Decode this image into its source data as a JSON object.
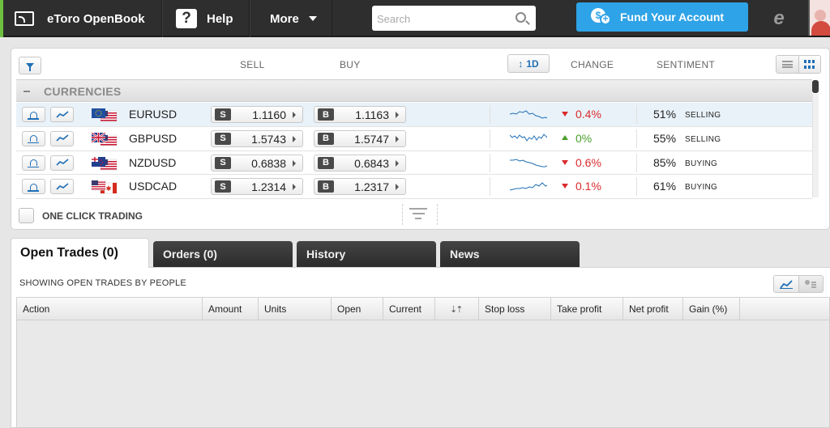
{
  "topbar": {
    "openbook_label": "eToro OpenBook",
    "help_label": "Help",
    "help_icon": "?",
    "more_label": "More",
    "search_placeholder": "Search",
    "fund_label": "Fund Your Account",
    "fund_icon_primary": "$",
    "fund_icon_plus": "+",
    "logo_glyph": "e"
  },
  "markets": {
    "headers": {
      "sell": "SELL",
      "buy": "BUY",
      "change": "CHANGE",
      "sentiment": "SENTIMENT"
    },
    "period": "1D",
    "period_icon": "↕",
    "category": "CURRENCIES",
    "rows": [
      {
        "symbol": "EURUSD",
        "sell_tag": "S",
        "sell": "1.1160",
        "buy_tag": "B",
        "buy": "1.1163",
        "direction": "down",
        "change": "0.4%",
        "pct": "51%",
        "sentiment": "SELLING"
      },
      {
        "symbol": "GBPUSD",
        "sell_tag": "S",
        "sell": "1.5743",
        "buy_tag": "B",
        "buy": "1.5747",
        "direction": "up",
        "change": "0%",
        "pct": "55%",
        "sentiment": "SELLING"
      },
      {
        "symbol": "NZDUSD",
        "sell_tag": "S",
        "sell": "0.6838",
        "buy_tag": "B",
        "buy": "0.6843",
        "direction": "down",
        "change": "0.6%",
        "pct": "85%",
        "sentiment": "BUYING"
      },
      {
        "symbol": "USDCAD",
        "sell_tag": "S",
        "sell": "1.2314",
        "buy_tag": "B",
        "buy": "1.2317",
        "direction": "down",
        "change": "0.1%",
        "pct": "61%",
        "sentiment": "BUYING"
      }
    ],
    "one_click_label": "ONE CLICK TRADING"
  },
  "tabs": {
    "open_trades": "Open Trades (0)",
    "orders": "Orders (0)",
    "history": "History",
    "news": "News"
  },
  "trades": {
    "label": "SHOWING OPEN TRADES BY PEOPLE",
    "sort_arrows": "⇣⇡",
    "columns": {
      "action": "Action",
      "amount": "Amount",
      "units": "Units",
      "open": "Open",
      "current": "Current",
      "stop_loss": "Stop loss",
      "take_profit": "Take profit",
      "net_profit": "Net profit",
      "gain": "Gain (%)"
    }
  },
  "colors": {
    "topbar": "#2e2e2e",
    "fund_button": "#2fa3e7",
    "accent_blue": "#1f6fb5",
    "negative": "#d92b2b",
    "positive": "#4a9e2b"
  }
}
